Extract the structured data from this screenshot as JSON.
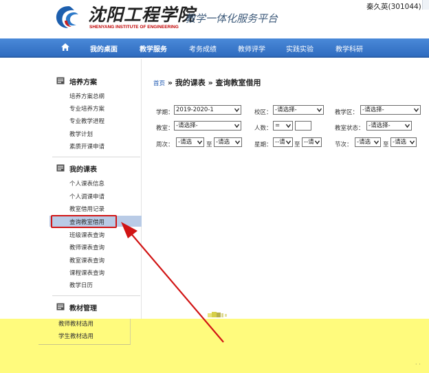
{
  "header": {
    "logo_cn": "沈阳工程学院",
    "logo_en": "SHENYANG INSTITUTE OF ENGINEERING",
    "platform_title": "教学一体化服务平台",
    "user": "秦久英(301044)"
  },
  "nav": {
    "items": [
      {
        "label": "我的桌面"
      },
      {
        "label": "教学服务"
      },
      {
        "label": "考务成绩"
      },
      {
        "label": "教师评学"
      },
      {
        "label": "实践实验"
      },
      {
        "label": "教学科研"
      }
    ]
  },
  "sidebar": {
    "sections": [
      {
        "title": "培养方案",
        "items": [
          "培养方案总纲",
          "专业培养方案",
          "专业教学进程",
          "教学计划",
          "素质开课申请"
        ]
      },
      {
        "title": "我的课表",
        "items": [
          "个人课表信息",
          "个人调课申请",
          "教室借用记录",
          "查询教室借用",
          "班级课表查询",
          "教师课表查询",
          "教室课表查询",
          "课程课表查询",
          "教学日历"
        ]
      },
      {
        "title": "教材管理",
        "items": [
          "教师教材选用",
          "学生教材选用"
        ]
      }
    ],
    "active_item": "查询教室借用"
  },
  "main": {
    "breadcrumb": {
      "home": "首页",
      "sep1": " » ",
      "section": "我的课表",
      "sep2": " » ",
      "page": "查询教室借用"
    },
    "filters": {
      "term_label": "学期：",
      "term_value": "2019-2020-1",
      "campus_label": "校区：",
      "campus_value": "-请选择-",
      "area_label": "教学区：",
      "area_value": "-请选择-",
      "room_label": "教室：",
      "room_value": "-请选择-",
      "people_label": "人数：",
      "people_op": "=",
      "status_label": "教室状态：",
      "status_value": "-请选择-",
      "week_label": "周次：",
      "week_from": "-请选",
      "week_to": "-请选",
      "day_label": "星期：",
      "day_from": "--请",
      "day_to": "--请",
      "period_label": "节次：",
      "period_from": "-请选",
      "period_to": "-请选",
      "to_word": "至"
    }
  },
  "overlay": {
    "dots": "· ·"
  },
  "colors": {
    "nav_blue": "#3a78c9",
    "highlight_red": "#d11414",
    "overlay_yellow": "#fffb7d",
    "active_row": "#b9cbe6"
  }
}
